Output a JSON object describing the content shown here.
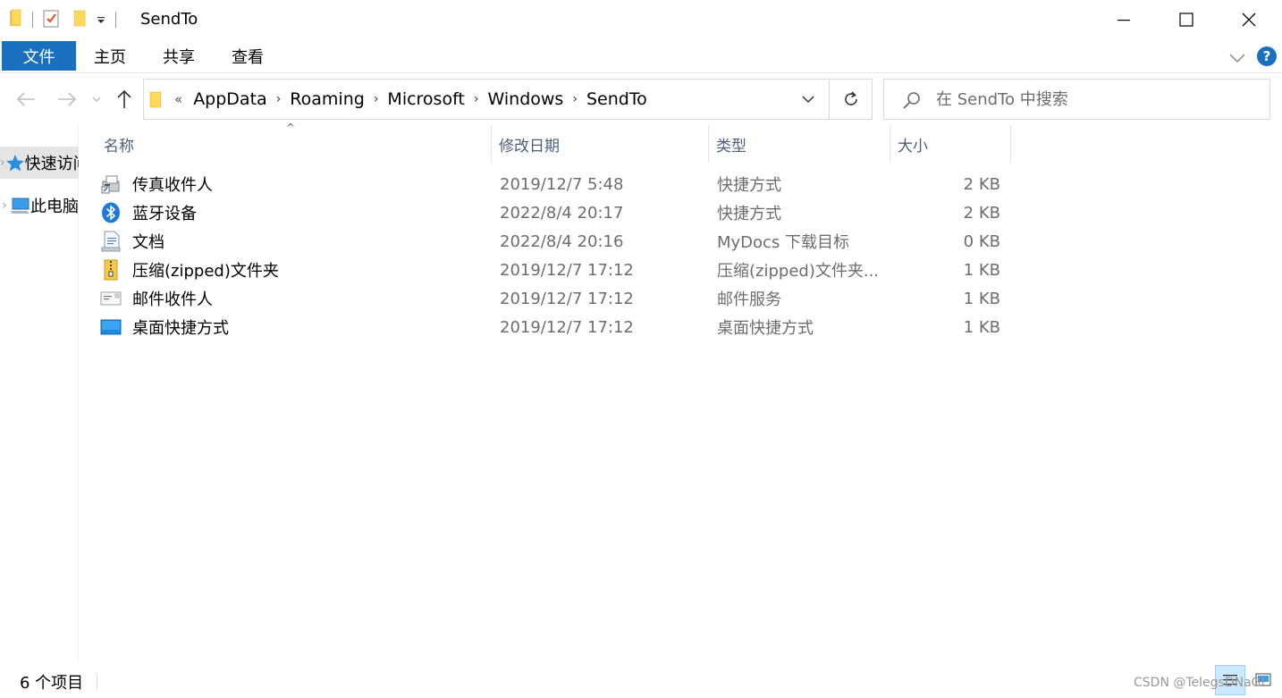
{
  "window": {
    "title": "SendTo",
    "minimize_glyph": "—",
    "maximize_glyph": "☐",
    "close_glyph": "✕"
  },
  "ribbon": {
    "tabs": [
      {
        "label": "文件"
      },
      {
        "label": "主页"
      },
      {
        "label": "共享"
      },
      {
        "label": "查看"
      }
    ],
    "help_label": "?"
  },
  "address": {
    "overflow": "«",
    "crumbs": [
      "AppData",
      "Roaming",
      "Microsoft",
      "Windows",
      "SendTo"
    ],
    "separator": "›"
  },
  "search": {
    "placeholder": "在 SendTo 中搜索"
  },
  "nav_pane": {
    "items": [
      {
        "label": "快速访问",
        "icon": "star-icon"
      },
      {
        "label": "此电脑",
        "icon": "computer-icon"
      }
    ],
    "expand_glyph": "›"
  },
  "columns": {
    "name": "名称",
    "date": "修改日期",
    "type": "类型",
    "size": "大小",
    "sort_glyph": "^"
  },
  "files": [
    {
      "name": "传真收件人",
      "date": "2019/12/7 5:48",
      "type": "快捷方式",
      "size": "2 KB",
      "icon": "fax-icon"
    },
    {
      "name": "蓝牙设备",
      "date": "2022/8/4 20:17",
      "type": "快捷方式",
      "size": "2 KB",
      "icon": "bluetooth-icon"
    },
    {
      "name": "文档",
      "date": "2022/8/4 20:16",
      "type": "MyDocs 下载目标",
      "size": "0 KB",
      "icon": "document-icon"
    },
    {
      "name": "压缩(zipped)文件夹",
      "date": "2019/12/7 17:12",
      "type": "压缩(zipped)文件夹...",
      "size": "1 KB",
      "icon": "zip-folder-icon"
    },
    {
      "name": "邮件收件人",
      "date": "2019/12/7 17:12",
      "type": "邮件服务",
      "size": "1 KB",
      "icon": "mail-icon"
    },
    {
      "name": "桌面快捷方式",
      "date": "2019/12/7 17:12",
      "type": "桌面快捷方式",
      "size": "1 KB",
      "icon": "desktop-icon"
    }
  ],
  "status": {
    "count": "6 个项目"
  },
  "watermark": "CSDN @TelegsDNaGI",
  "colors": {
    "accent": "#1a6fbf",
    "folder": "#f3c842",
    "header_text": "#4c607a"
  }
}
